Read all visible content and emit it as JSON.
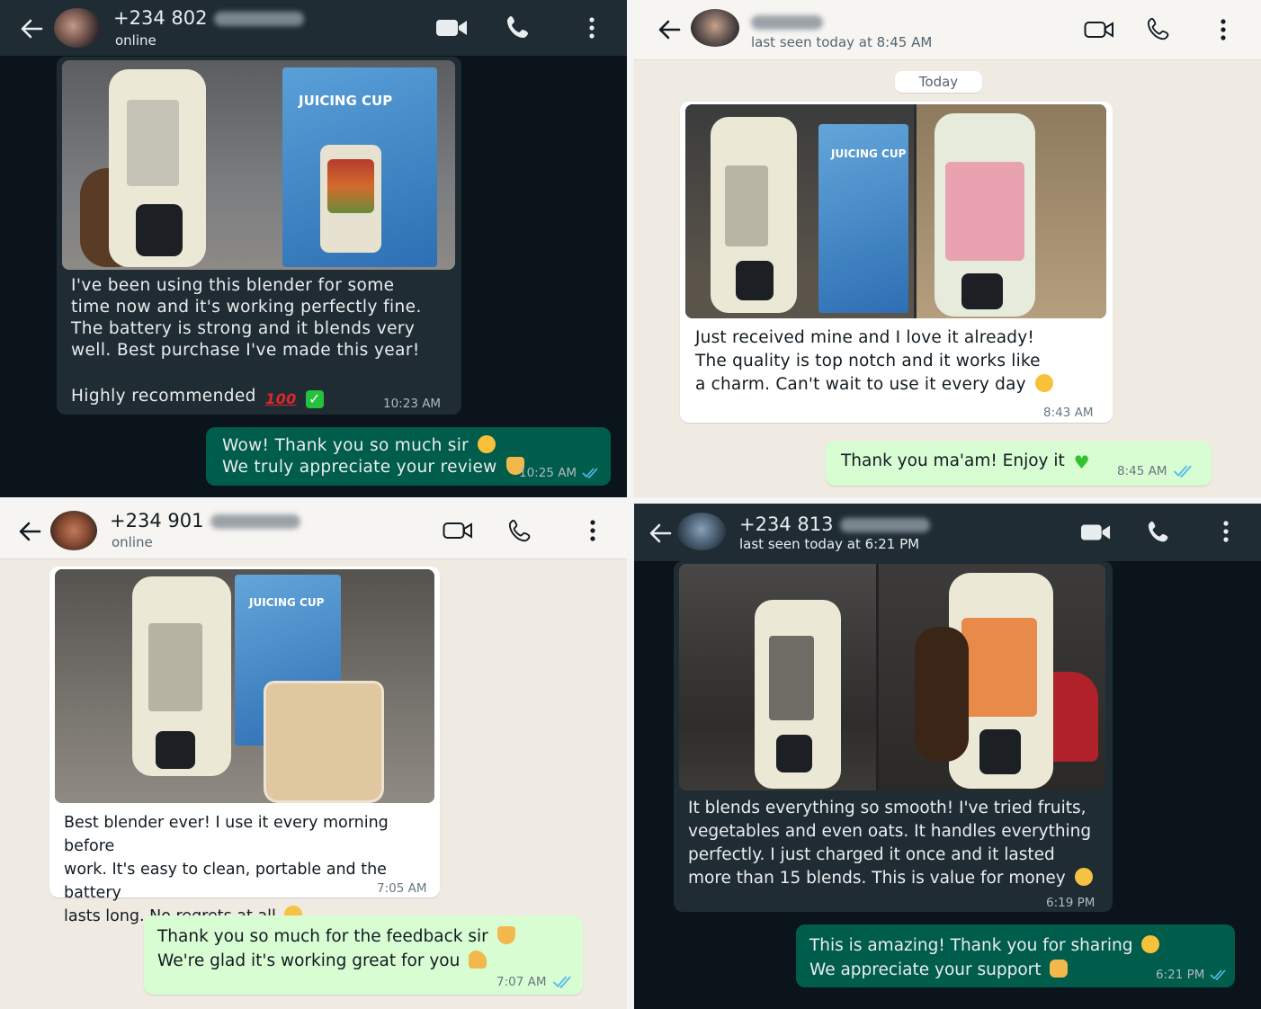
{
  "colors": {
    "dark_bg": "#0b141a",
    "dark_header": "#1f2c34",
    "dark_in": "#202c33",
    "dark_out": "#005c4b",
    "light_bg": "#efeae2",
    "light_out": "#d9fdd3",
    "tick_blue": "#53bdeb"
  },
  "chats": [
    {
      "header": {
        "name": "+234 802",
        "status": "online"
      },
      "photo": {
        "box_label": "JUICING CUP"
      },
      "incoming": {
        "lines": [
          "I've been using this blender for some",
          "time now and it's working perfectly fine.",
          "The battery is strong and it blends very",
          "well. Best purchase I've made this year!"
        ],
        "last_line": "Highly recommended",
        "time": "10:23 AM"
      },
      "outgoing": {
        "lines": [
          "Wow! Thank you so much sir",
          "We truly appreciate your review"
        ],
        "time": "10:25 AM"
      }
    },
    {
      "header": {
        "name": "",
        "status": "last seen today at 8:45 AM"
      },
      "date_chip": "Today",
      "photo": {
        "box_label": "JUICING CUP"
      },
      "incoming": {
        "lines": [
          "Just received mine and I love it already!",
          "The quality is top notch and it works like",
          "a charm. Can't wait to use it every day"
        ],
        "time": "8:43 AM"
      },
      "outgoing": {
        "lines": [
          "Thank you ma'am! Enjoy it"
        ],
        "time": "8:45 AM"
      }
    },
    {
      "header": {
        "name": "+234 901",
        "status": "online"
      },
      "photo": {
        "box_label": "JUICING CUP"
      },
      "incoming": {
        "lines": [
          "Best blender ever! I use it every morning before",
          "work. It's easy to clean, portable and the battery",
          "lasts long. No regrets at all"
        ],
        "time": "7:05 AM"
      },
      "outgoing": {
        "lines": [
          "Thank you so much for the feedback sir",
          "We're glad it's working great for you"
        ],
        "time": "7:07 AM"
      }
    },
    {
      "header": {
        "name": "+234 813",
        "status": "last seen today at 6:21 PM"
      },
      "incoming": {
        "lines": [
          "It blends everything so smooth! I've tried fruits,",
          "vegetables and even oats. It handles everything",
          "perfectly. I just charged it once and it lasted",
          "more than 15 blends. This is value for money"
        ],
        "time": "6:19 PM"
      },
      "outgoing": {
        "lines": [
          "This is amazing! Thank you for sharing",
          "We appreciate your support"
        ],
        "time": "6:21 PM"
      }
    }
  ]
}
